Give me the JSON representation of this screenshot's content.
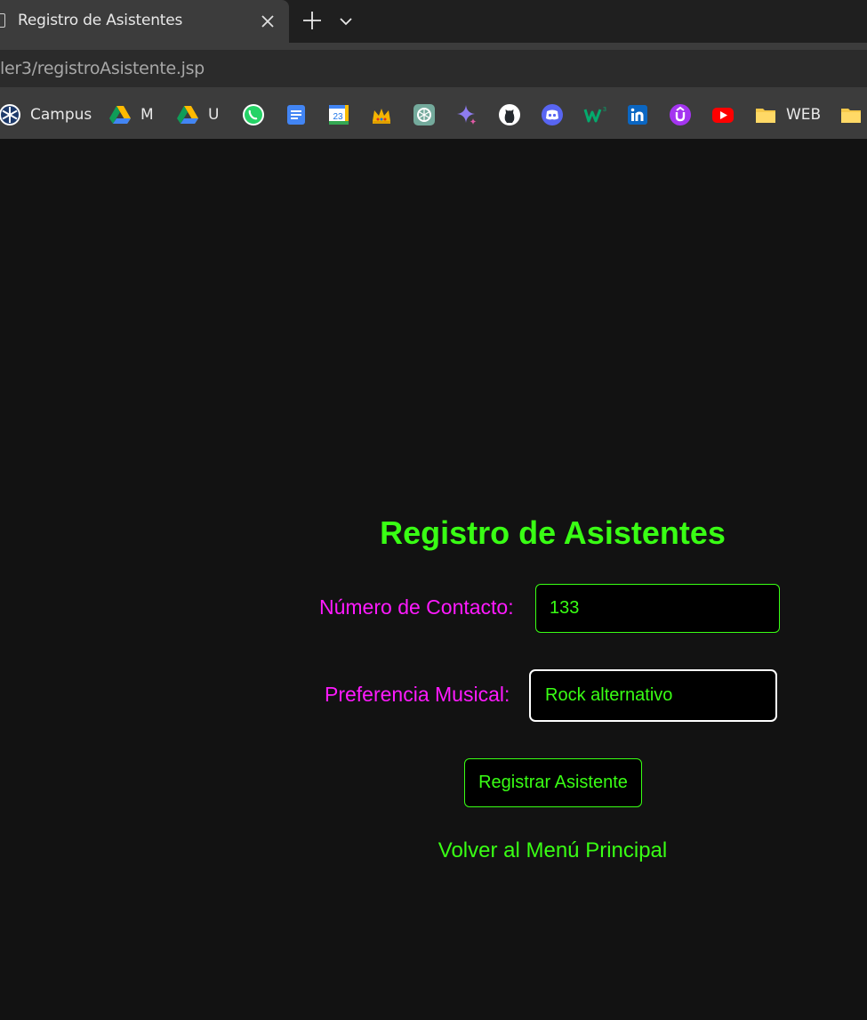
{
  "browser": {
    "tab_title": "Registro de Asistentes",
    "url": "ler3/registroAsistente.jsp",
    "bookmarks": [
      {
        "label": "Campus",
        "icon": "campus-icon"
      },
      {
        "label": "M",
        "icon": "google-drive-icon"
      },
      {
        "label": "U",
        "icon": "google-drive-icon"
      },
      {
        "label": "",
        "icon": "whatsapp-icon"
      },
      {
        "label": "",
        "icon": "google-docs-icon"
      },
      {
        "label": "",
        "icon": "google-calendar-icon"
      },
      {
        "label": "",
        "icon": "crown-icon"
      },
      {
        "label": "",
        "icon": "chatgpt-icon"
      },
      {
        "label": "",
        "icon": "gemini-icon"
      },
      {
        "label": "",
        "icon": "github-icon"
      },
      {
        "label": "",
        "icon": "discord-icon"
      },
      {
        "label": "",
        "icon": "w3-icon"
      },
      {
        "label": "",
        "icon": "linkedin-icon"
      },
      {
        "label": "",
        "icon": "udemy-icon"
      },
      {
        "label": "",
        "icon": "youtube-icon"
      },
      {
        "label": "WEB",
        "icon": "folder-icon"
      },
      {
        "label": "",
        "icon": "folder-icon"
      }
    ],
    "calendar_day": "23"
  },
  "page": {
    "title": "Registro de Asistentes",
    "form": {
      "contact_label": "Número de Contacto:",
      "contact_value": "133",
      "music_label": "Preferencia Musical:",
      "music_value": "Rock alternativo",
      "submit_label": "Registrar Asistente"
    },
    "back_link": "Volver al Menú Principal"
  },
  "colors": {
    "background": "#121212",
    "accent_green": "#39ff14",
    "label_magenta": "#ff1aff"
  }
}
